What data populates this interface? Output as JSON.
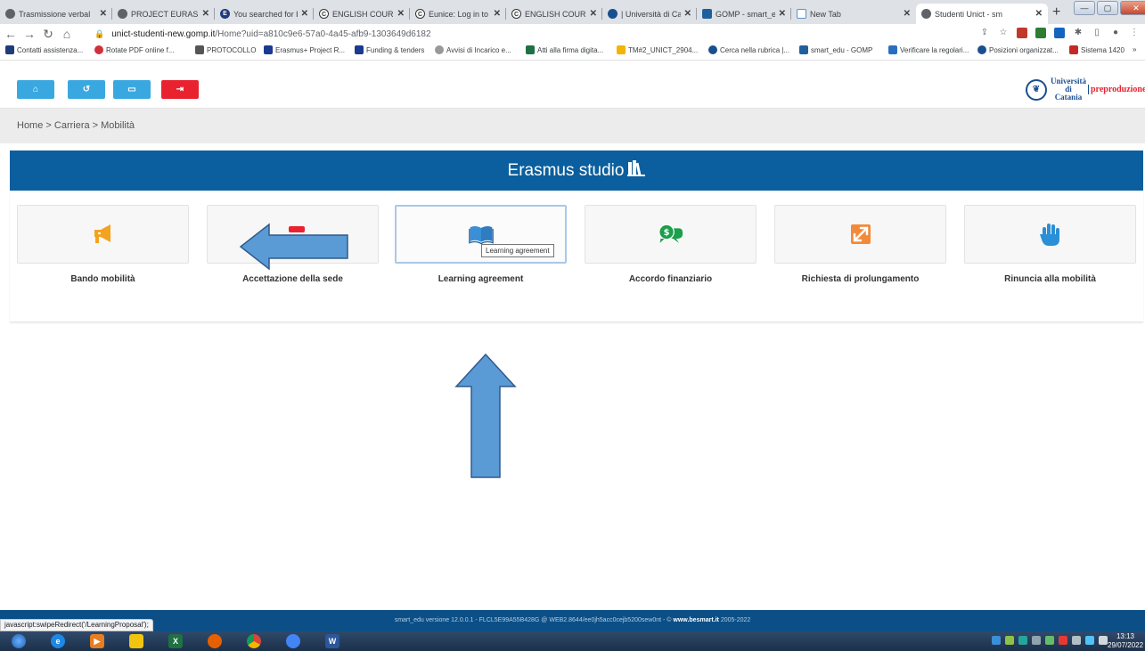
{
  "browser": {
    "tabs": [
      {
        "title": "Trasmissione verbal",
        "active": false
      },
      {
        "title": "PROJECT EURASIA",
        "active": false
      },
      {
        "title": "You searched for b",
        "active": false
      },
      {
        "title": "ENGLISH COURSES",
        "active": false
      },
      {
        "title": "Eunice: Log in to th",
        "active": false
      },
      {
        "title": "ENGLISH COURSES",
        "active": false
      },
      {
        "title": "| Università di Cata",
        "active": false
      },
      {
        "title": "GOMP - smart_edu",
        "active": false
      },
      {
        "title": "New Tab",
        "active": false
      },
      {
        "title": "Studenti Unict - sm",
        "active": true
      }
    ],
    "url_host": "unict-studenti-new.gomp.it",
    "url_path": "/Home?uid=a810c9e6-57a0-4a45-afb9-1303649d6182",
    "bookmarks": [
      "Contatti assistenza...",
      "Rotate PDF online f...",
      "PROTOCOLLO",
      "Erasmus+ Project R...",
      "Funding & tenders",
      "Avvisi di Incarico e...",
      "Atti alla firma digita...",
      "TM#2_UNICT_2904...",
      "Cerca nella rubrica |...",
      "smart_edu - GOMP",
      "Verificare la regolari...",
      "Posizioni organizzat...",
      "Sistema 1420"
    ],
    "status_url": "javascript:swipeRedirect('/LearningProposal');"
  },
  "logo": {
    "university_line1": "Università",
    "university_line2": "di Catania",
    "environment": "preproduzione"
  },
  "breadcrumb": "Home > Carriera > Mobilità",
  "section": {
    "title": "Erasmus studio"
  },
  "cards": [
    {
      "label": "Bando mobilità",
      "icon": "megaphone-icon",
      "color": "#f4a321"
    },
    {
      "label": "Accettazione della sede",
      "icon": "stamp-icon",
      "color": "#e8232f"
    },
    {
      "label": "Learning agreement",
      "icon": "open-book-icon",
      "color": "#3a8fd6"
    },
    {
      "label": "Accordo finanziario",
      "icon": "money-chat-icon",
      "color": "#1a9f4b"
    },
    {
      "label": "Richiesta di prolungamento",
      "icon": "expand-arrows-icon",
      "color": "#f28a3a"
    },
    {
      "label": "Rinuncia alla mobilità",
      "icon": "hand-icon",
      "color": "#2a8fd6"
    }
  ],
  "tooltip": "Learning agreement",
  "footer": {
    "version_text": "smart_edu versione 12.0.0.1 - FLCL5E99A55B428G @ WEB2.8644/ee0jh5acc0cejb5200sew0nt - © ",
    "site": "www.besmart.it",
    "years": " 2005-2022"
  },
  "taskbar": {
    "time": "13:13",
    "date": "29/07/2022"
  },
  "colors": {
    "header_blue": "#0b5f9e",
    "toolbar_blue": "#3aa8e0",
    "toolbar_red": "#e8232f",
    "arrow_fill": "#5b9bd5",
    "arrow_stroke": "#2e5b8c"
  }
}
